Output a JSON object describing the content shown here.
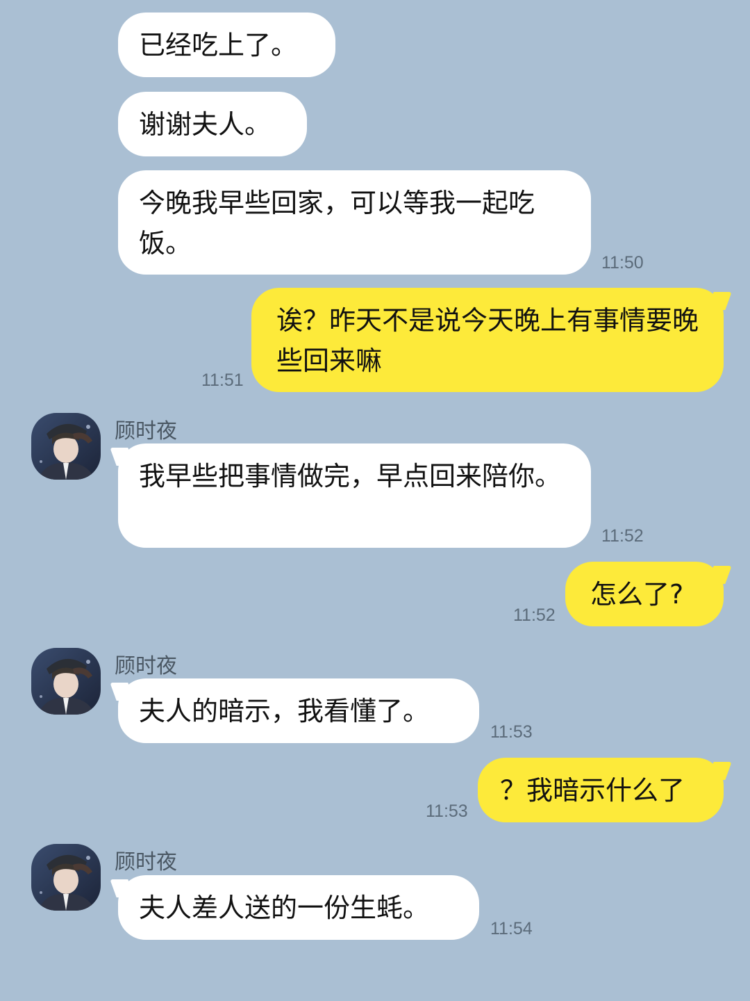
{
  "contact": {
    "name": "顾时夜"
  },
  "messages": [
    {
      "text": "已经吃上了。"
    },
    {
      "text": "谢谢夫人。"
    },
    {
      "text": "今晚我早些回家，可以等我一起吃饭。",
      "time": "11:50"
    },
    {
      "text": "诶？昨天不是说今天晚上有事情要晚些回来嘛",
      "time": "11:51"
    },
    {
      "sender": "顾时夜",
      "text": "我早些把事情做完，早点回来陪你。",
      "time": "11:52"
    },
    {
      "text": "怎么了?",
      "time": "11:52"
    },
    {
      "sender": "顾时夜",
      "text": "夫人的暗示，我看懂了。",
      "time": "11:53"
    },
    {
      "text": "？我暗示什么了",
      "time": "11:53"
    },
    {
      "sender": "顾时夜",
      "text": "夫人差人送的一份生蚝。",
      "time": "11:54"
    }
  ],
  "colors": {
    "background": "#aabfd3",
    "incoming_bubble": "#ffffff",
    "outgoing_bubble": "#fdea3a"
  },
  "icons": {
    "avatar": "avatar-icon"
  }
}
